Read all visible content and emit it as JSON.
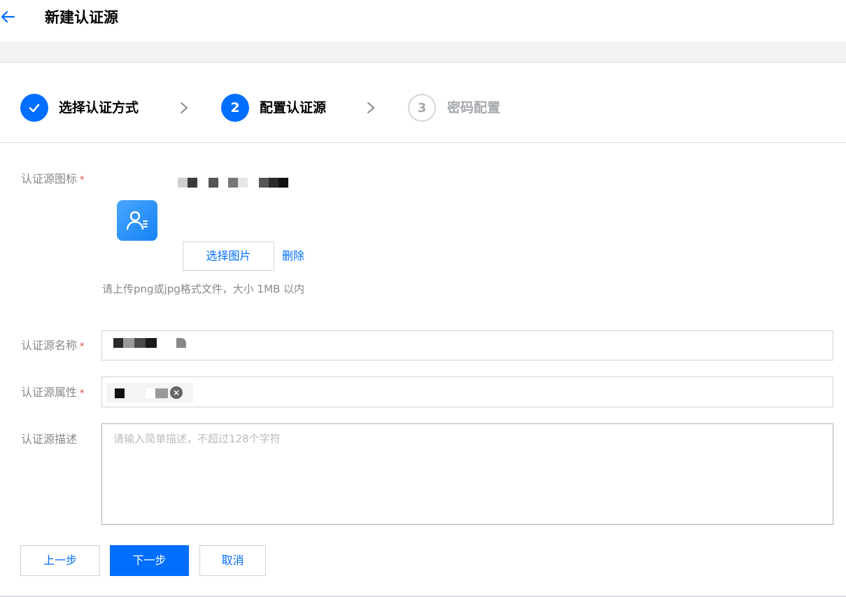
{
  "header": {
    "back_icon": "arrow-left-icon",
    "title": "新建认证源"
  },
  "steps": [
    {
      "index": "1",
      "label": "选择认证方式",
      "status": "done",
      "icon": "check-icon"
    },
    {
      "index": "2",
      "label": "配置认证源",
      "status": "active"
    },
    {
      "index": "3",
      "label": "密码配置",
      "status": "pending"
    }
  ],
  "step_separator_icon": "chevron-right-icon",
  "form": {
    "icon": {
      "label": "认证源图标",
      "required_mark": "*",
      "app_icon": "user-list-icon",
      "choose_button": "选择图片",
      "delete_link": "删除",
      "hint": "请上传png或jpg格式文件，大小 1MB 以内"
    },
    "name": {
      "label": "认证源名称",
      "required_mark": "*"
    },
    "attribute": {
      "label": "认证源属性",
      "required_mark": "*",
      "tag_remove_icon": "close-circle-icon"
    },
    "description": {
      "label": "认证源描述",
      "placeholder": "请输入简单描述，不超过128个字符",
      "value": ""
    }
  },
  "actions": {
    "prev": "上一步",
    "next": "下一步",
    "cancel": "取消"
  },
  "colors": {
    "accent": "#006eff",
    "required": "#e54545",
    "muted_text": "#888888",
    "band_bg": "#f2f3f5"
  }
}
